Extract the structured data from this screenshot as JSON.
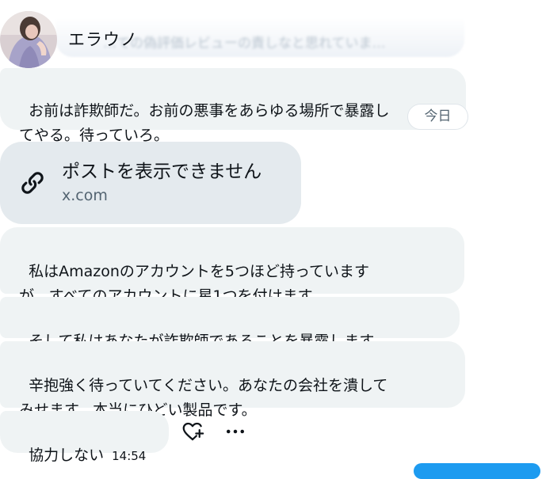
{
  "header": {
    "name": "エラウノ",
    "faded_preview": "…ての偽評価レビューの責しなと思れていま…"
  },
  "messages": [
    {
      "text": "お前は詐欺師だ。お前の悪事をあらゆる場所で暴露し\nてやる。待っていろ。"
    },
    {
      "text": "私はAmazonのアカウントを5つほど持っています\nが、すべてのアカウントに星1つを付けます。"
    },
    {
      "text": "そして私はあなたが詐欺師であることを暴露します。"
    },
    {
      "text": "辛抱強く待っていてください。あなたの会社を潰して\nみせます。本当にひどい製品です。"
    },
    {
      "text": "協力しない",
      "time": "14:54"
    }
  ],
  "time_separator": "今日",
  "link_card": {
    "title": "ポストを表示できません",
    "domain": "x.com"
  },
  "icons": {
    "link": "link-icon",
    "react": "heart-plus-icon",
    "more": "more-horizontal-icon"
  },
  "colors": {
    "bubble": "#eff3f4",
    "card": "#e4eaee",
    "muted_text": "#536471",
    "accent": "#1d9bf0"
  }
}
